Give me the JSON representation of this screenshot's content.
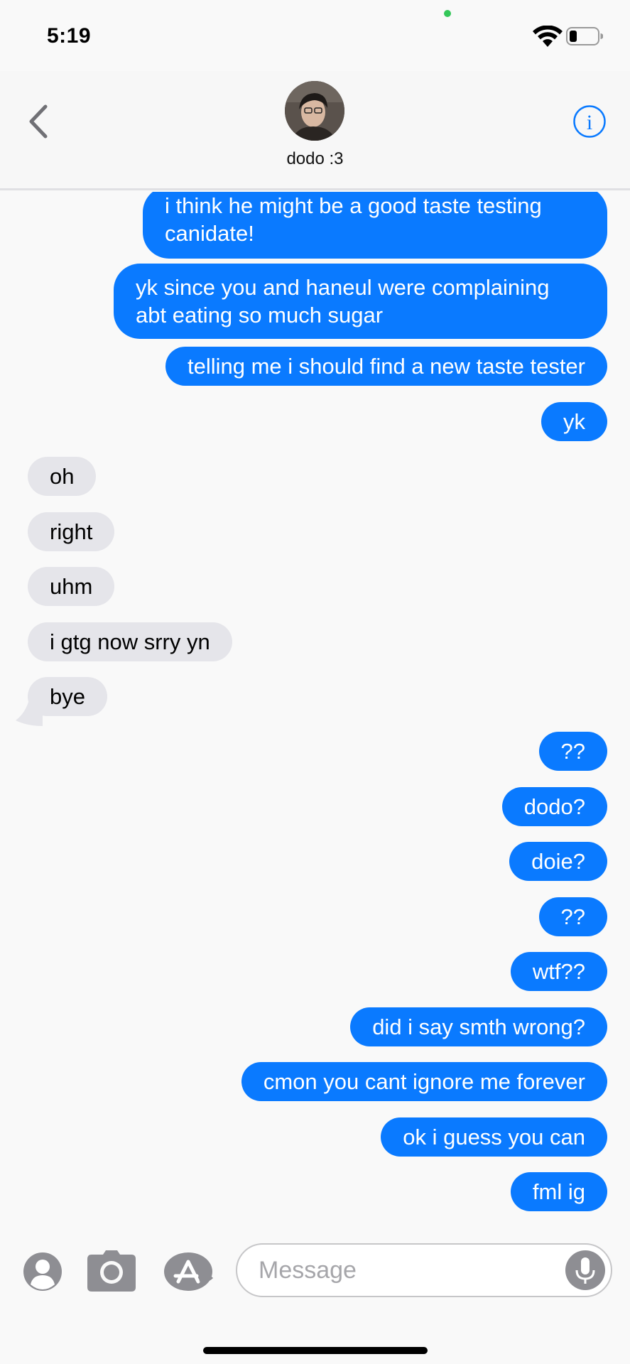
{
  "status_bar": {
    "time": "5:19"
  },
  "header": {
    "contact_name": "dodo :3"
  },
  "messages": [
    {
      "from": "me",
      "text": "i think he might be a good taste testing canidate!"
    },
    {
      "from": "me",
      "text": "yk since you and haneul were complaining abt eating so much sugar"
    },
    {
      "from": "me",
      "text": "telling me i should find a new taste tester"
    },
    {
      "from": "me",
      "text": "yk"
    },
    {
      "from": "them",
      "text": "oh"
    },
    {
      "from": "them",
      "text": "right"
    },
    {
      "from": "them",
      "text": "uhm"
    },
    {
      "from": "them",
      "text": "i gtg now srry yn"
    },
    {
      "from": "them",
      "text": "bye"
    },
    {
      "from": "me",
      "text": "??"
    },
    {
      "from": "me",
      "text": "dodo?"
    },
    {
      "from": "me",
      "text": "doie?"
    },
    {
      "from": "me",
      "text": "??"
    },
    {
      "from": "me",
      "text": "wtf??"
    },
    {
      "from": "me",
      "text": "did i say smth wrong?"
    },
    {
      "from": "me",
      "text": "cmon you cant ignore me forever"
    },
    {
      "from": "me",
      "text": "ok i guess you can"
    },
    {
      "from": "me",
      "text": "fml ig"
    }
  ],
  "input": {
    "placeholder": "Message",
    "value": ""
  },
  "icons": [
    "back-chevron-icon",
    "info-icon",
    "contact-icon",
    "camera-icon",
    "app-store-icon",
    "microphone-icon",
    "wifi-icon",
    "battery-icon"
  ],
  "colors": {
    "outgoing": "#0a7aff",
    "incoming": "#e5e5ea",
    "accent": "#0a7aff"
  }
}
